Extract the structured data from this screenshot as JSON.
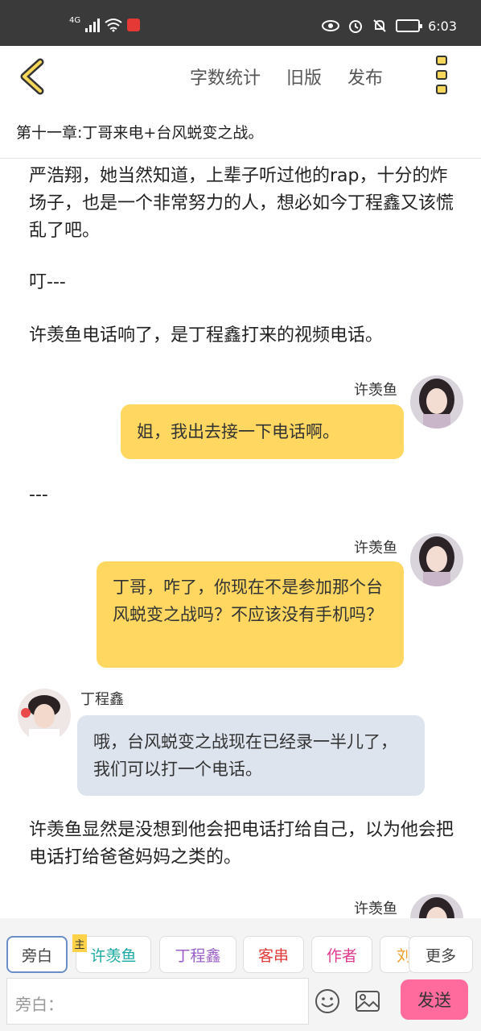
{
  "status_bar": {
    "network": "4G",
    "time": "6:03"
  },
  "app_bar": {
    "menu": [
      "字数统计",
      "旧版",
      "发布"
    ]
  },
  "chapter_title": "第十一章:丁哥来电+台风蜕变之战。",
  "content": {
    "p1": "严浩翔，她当然知道，上辈子听过他的rap，十分的炸场子，也是一个非常努力的人，想必如今丁程鑫又该慌乱了吧。",
    "p2": "叮---",
    "p3": "许羡鱼电话响了，是丁程鑫打来的视频电话。",
    "b1_name": "许羡鱼",
    "b1_text": "姐，我出去接一下电话啊。",
    "p4": "---",
    "b2_name": "许羡鱼",
    "b2_text": "丁哥，咋了，你现在不是参加那个台风蜕变之战吗？不应该没有手机吗？",
    "b3_name": "丁程鑫",
    "b3_text": "哦，台风蜕变之战现在已经录一半儿了，我们可以打一个电话。",
    "p5": "许羡鱼显然是没想到他会把电话打给自己，以为他会把电话打给爸爸妈妈之类的。",
    "b4_name": "许羡鱼"
  },
  "bottom_bar": {
    "chips": [
      "旁白",
      "许羡鱼",
      "丁程鑫",
      "客串",
      "作者",
      "刘",
      "更多"
    ],
    "main_tag": "主",
    "input_placeholder": "旁白：",
    "send_label": "发送"
  },
  "colors": {
    "bubble_self": "#ffd761",
    "bubble_other": "#dde4ee",
    "send": "#ff6b9d",
    "chip_xu": "#1aa9a2",
    "chip_ding": "#9b5fc9",
    "chip_guest": "#e03a3a",
    "chip_author": "#e0398f",
    "chip_liu": "#f0a030"
  }
}
